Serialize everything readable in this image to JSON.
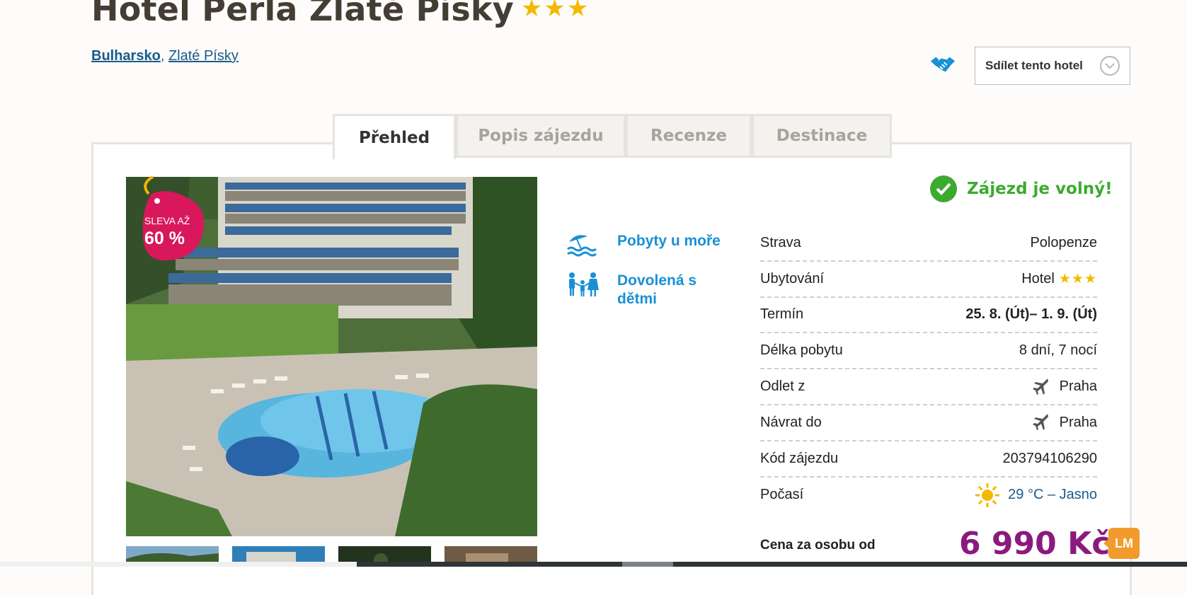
{
  "hotel": {
    "name": "Hotel Perla Zlaté Písky",
    "stars": "★★★"
  },
  "breadcrumb": {
    "country": "Bulharsko",
    "separator": ",",
    "resort": "Zlaté Písky"
  },
  "share": {
    "label": "Sdílet tento hotel"
  },
  "tabs": [
    {
      "label": "Přehled",
      "active": true
    },
    {
      "label": "Popis zájezdu"
    },
    {
      "label": "Recenze"
    },
    {
      "label": "Destinace"
    }
  ],
  "promo_tag": {
    "line1": "SLEVA AŽ",
    "line2": "60 %"
  },
  "categories": [
    {
      "label": "Pobyty u moře",
      "icon": "beach-icon"
    },
    {
      "label": "Dovolená s dětmi",
      "icon": "family-icon"
    }
  ],
  "availability": {
    "text": "Zájezd je volný!"
  },
  "details": [
    {
      "label": "Strava",
      "value": "Polopenze"
    },
    {
      "label": "Ubytování",
      "value": "Hotel",
      "stars": "★★★"
    },
    {
      "label": "Termín",
      "value": "25. 8. (Út)– 1. 9. (Út)"
    },
    {
      "label": "Délka pobytu",
      "value": "8 dní, 7 nocí"
    },
    {
      "label": "Odlet z",
      "value": "Praha",
      "icon": "plane-icon"
    },
    {
      "label": "Návrat do",
      "value": "Praha",
      "icon": "plane-icon"
    },
    {
      "label": "Kód zájezdu",
      "value": "203794106290"
    },
    {
      "label": "Počasí",
      "value": "29 °C – Jasno",
      "icon": "sun-icon"
    }
  ],
  "price": {
    "label": "Cena za osobu od",
    "value": "6 990 Kč",
    "badge": "LM"
  },
  "colors": {
    "accent": "#1890d6",
    "available": "#3caa2e",
    "price": "#8b1a7e",
    "badge": "#f29a2b",
    "promo": "#d8185b"
  }
}
